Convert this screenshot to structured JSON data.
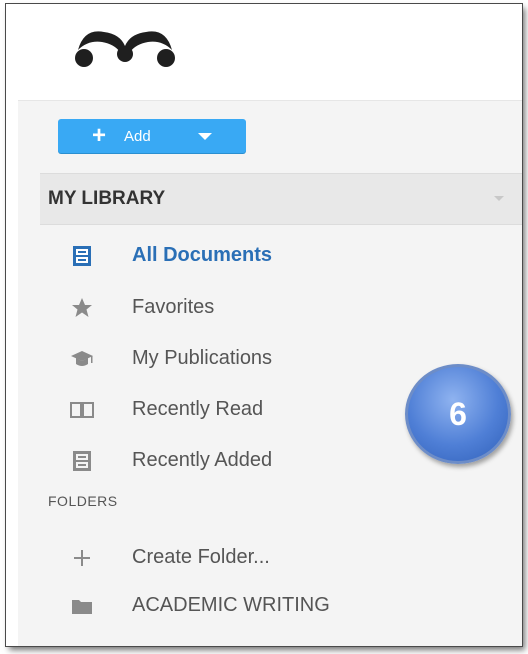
{
  "toolbar": {
    "add_label": "Add",
    "add_icon": "plus-icon"
  },
  "library": {
    "title": "MY LIBRARY",
    "items": [
      {
        "label": "All Documents",
        "icon": "document-icon",
        "active": true
      },
      {
        "label": "Favorites",
        "icon": "star-icon"
      },
      {
        "label": "My Publications",
        "icon": "graduation-cap-icon"
      },
      {
        "label": "Recently Read",
        "icon": "open-book-icon"
      },
      {
        "label": "Recently Added",
        "icon": "document-icon"
      }
    ]
  },
  "folders": {
    "title": "FOLDERS",
    "items": [
      {
        "label": "Create Folder...",
        "icon": "plus-icon"
      },
      {
        "label": "ACADEMIC WRITING",
        "icon": "folder-icon"
      }
    ]
  },
  "badge": {
    "number": "6"
  },
  "colors": {
    "accent": "#39a9f4",
    "active_text": "#2a6fb6",
    "panel_bg": "#f4f4f4",
    "badge": "#4f7fd6"
  }
}
